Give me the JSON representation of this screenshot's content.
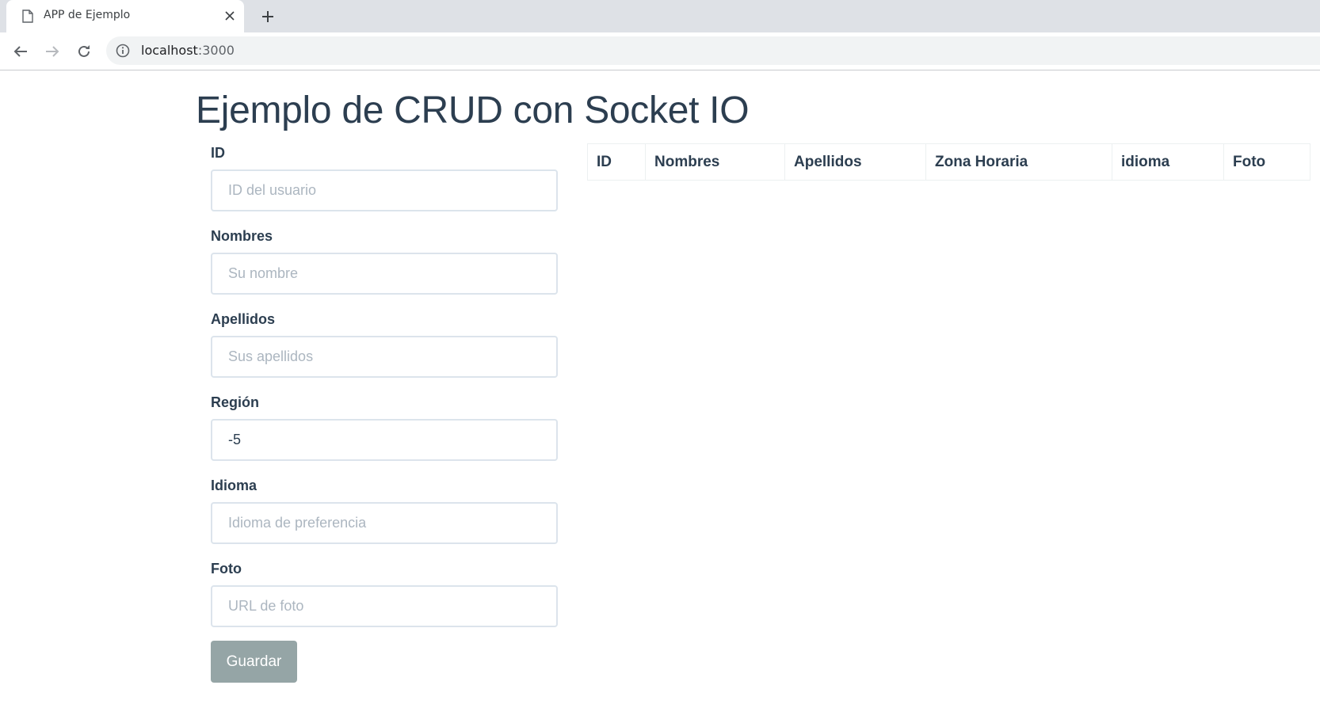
{
  "browser": {
    "tab_title": "APP de Ejemplo",
    "url_host": "localhost",
    "url_port": ":3000",
    "icons": [
      "document-icon",
      "close-icon",
      "plus-icon",
      "back-arrow-icon",
      "forward-arrow-icon",
      "reload-icon",
      "info-icon"
    ]
  },
  "page": {
    "title": "Ejemplo de CRUD con Socket IO"
  },
  "form": {
    "id": {
      "label": "ID",
      "placeholder": "ID del usuario",
      "value": ""
    },
    "nombres": {
      "label": "Nombres",
      "placeholder": "Su nombre",
      "value": ""
    },
    "apellidos": {
      "label": "Apellidos",
      "placeholder": "Sus apellidos",
      "value": ""
    },
    "region": {
      "label": "Región",
      "placeholder": "",
      "value": "-5"
    },
    "idioma": {
      "label": "Idioma",
      "placeholder": "Idioma de preferencia",
      "value": ""
    },
    "foto": {
      "label": "Foto",
      "placeholder": "URL de foto",
      "value": ""
    },
    "save_label": "Guardar"
  },
  "table": {
    "columns": [
      "ID",
      "Nombres",
      "Apellidos",
      "Zona Horaria",
      "idioma",
      "Foto"
    ],
    "rows": []
  },
  "colors": {
    "text": "#2c3e50",
    "input_border": "#dce4ec",
    "placeholder": "#acb6c0",
    "button": "#95a5a6",
    "tabstrip": "#dee1e6"
  }
}
